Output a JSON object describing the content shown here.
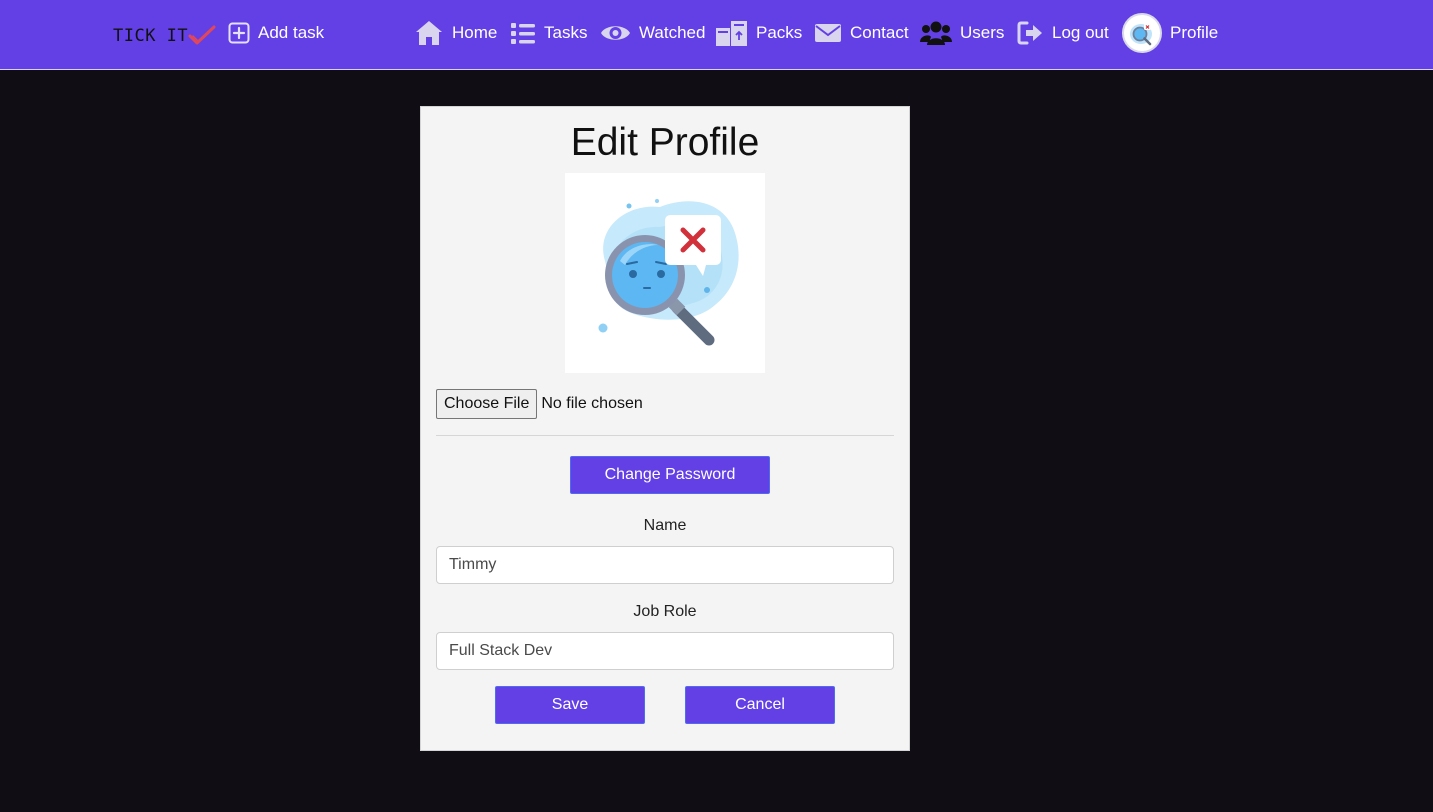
{
  "navbar": {
    "brand": "TICK IT",
    "add_task": "Add task",
    "items": [
      {
        "label": "Home",
        "icon": "home-icon"
      },
      {
        "label": "Tasks",
        "icon": "list-icon"
      },
      {
        "label": "Watched",
        "icon": "eye-icon"
      },
      {
        "label": "Packs",
        "icon": "boxes-icon"
      },
      {
        "label": "Contact",
        "icon": "envelope-icon"
      },
      {
        "label": "Users",
        "icon": "users-icon"
      },
      {
        "label": "Log out",
        "icon": "logout-icon"
      },
      {
        "label": "Profile",
        "icon": "avatar"
      }
    ]
  },
  "form": {
    "title": "Edit Profile",
    "choose_file": "Choose File",
    "file_status": "No file chosen",
    "change_password": "Change Password",
    "name_label": "Name",
    "name_value": "Timmy",
    "job_label": "Job Role",
    "job_value": "Full Stack Dev",
    "save": "Save",
    "cancel": "Cancel"
  },
  "colors": {
    "navbar": "#6340e6",
    "background": "#100e14",
    "card": "#f4f4f4",
    "primary_button": "#6340e6",
    "brand_check": "#e0475a"
  }
}
